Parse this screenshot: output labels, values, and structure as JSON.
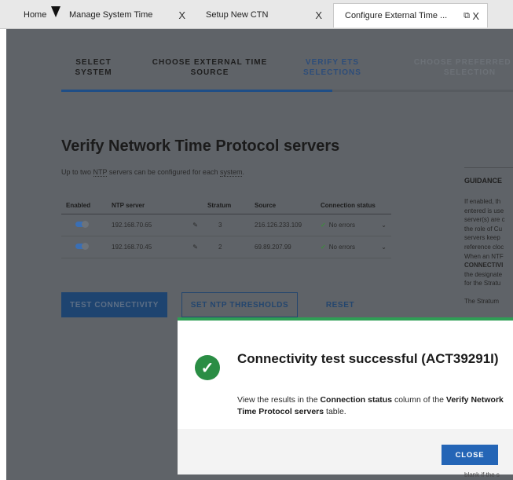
{
  "tabs": [
    {
      "label": "Home"
    },
    {
      "label": "Manage System Time",
      "close": "X"
    },
    {
      "label": "Setup New CTN",
      "close": "X"
    },
    {
      "label": "Configure External Time ...",
      "popout": "⧉",
      "close": "X"
    }
  ],
  "steps": [
    {
      "line1": "SELECT",
      "line2": "SYSTEM",
      "state": "done"
    },
    {
      "line1": "CHOOSE EXTERNAL TIME",
      "line2": "SOURCE",
      "state": "done"
    },
    {
      "line1": "VERIFY ETS",
      "line2": "SELECTIONS",
      "state": "current"
    },
    {
      "line1": "CHOOSE PREFERRED ET",
      "line2": "SELECTION",
      "state": "next"
    }
  ],
  "page": {
    "title": "Verify Network Time Protocol servers",
    "intro_pre": "Up to two ",
    "intro_abbr": "NTP",
    "intro_mid": " servers can be configured for each ",
    "intro_link": "system",
    "intro_post": "."
  },
  "table": {
    "headers": {
      "enabled": "Enabled",
      "server": "NTP server",
      "stratum": "Stratum",
      "source": "Source",
      "status": "Connection status"
    },
    "rows": [
      {
        "server": "192.168.70.65",
        "stratum": "3",
        "source": "216.126.233.109",
        "status": "No errors"
      },
      {
        "server": "192.168.70.45",
        "stratum": "2",
        "source": "69.89.207.99",
        "status": "No errors"
      }
    ]
  },
  "buttons": {
    "test": "TEST CONNECTIVITY",
    "thresholds": "SET NTP THRESHOLDS",
    "reset": "RESET"
  },
  "guidance": {
    "heading": "GUIDANCE",
    "lines": [
      "If enabled, th",
      "entered is use",
      "server(s) are c",
      "the role of Cu",
      "servers keep",
      "reference cloc",
      "When an NTF",
      "CONNECTIVI",
      "the designate",
      "for the Stratu",
      "",
      "The Stratum"
    ]
  },
  "modal": {
    "title": "Connectivity test successful (ACT39291I)",
    "body_pre": "View the results in the ",
    "body_b1": "Connection status",
    "body_mid": " column of the ",
    "body_b2": "Verify Network Time Protocol servers",
    "body_post": " table.",
    "close_label": "CLOSE"
  },
  "bottom_peek": "blank if the s",
  "colors": {
    "success": "#2a8d44",
    "primary": "#2465b6",
    "dim_overlay": "#5f6368"
  }
}
